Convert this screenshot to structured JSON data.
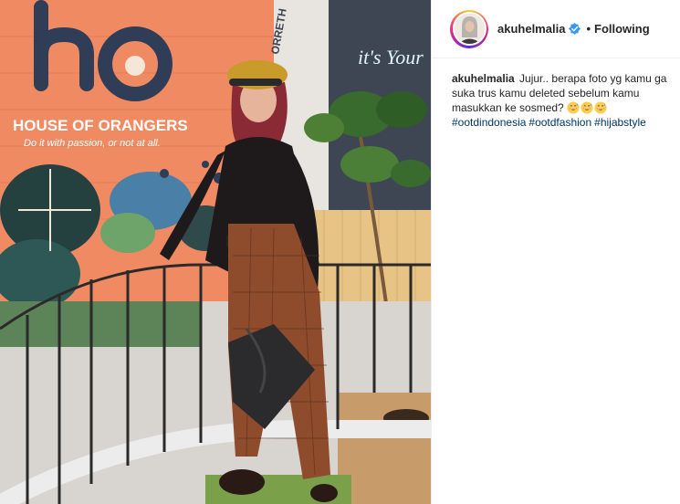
{
  "post": {
    "username": "akuhelmalia",
    "follow_state": "Following",
    "separator": "•",
    "caption": {
      "username": "akuhelmalia",
      "text": "Jujur.. berapa foto yg kamu ga suka trus kamu deleted sebelum kamu masukkan ke sosmed?",
      "emojis": [
        "grinning-sweat-emoji",
        "grinning-sweat-emoji",
        "grinning-sweat-emoji"
      ],
      "hashtags": [
        "#ootdindonesia",
        "#ootdfashion",
        "#hijabstyle"
      ]
    },
    "verified": true
  },
  "photo": {
    "mural_brand": "HOUSE OF ORANGERS",
    "mural_tagline": "Do it with passion, or not at all.",
    "mural_logo_text": "ho",
    "neon_text": "it's Your",
    "shop_sign": "ORRETH"
  },
  "colors": {
    "link": "#003569",
    "text": "#262626",
    "divider": "#efefef"
  }
}
